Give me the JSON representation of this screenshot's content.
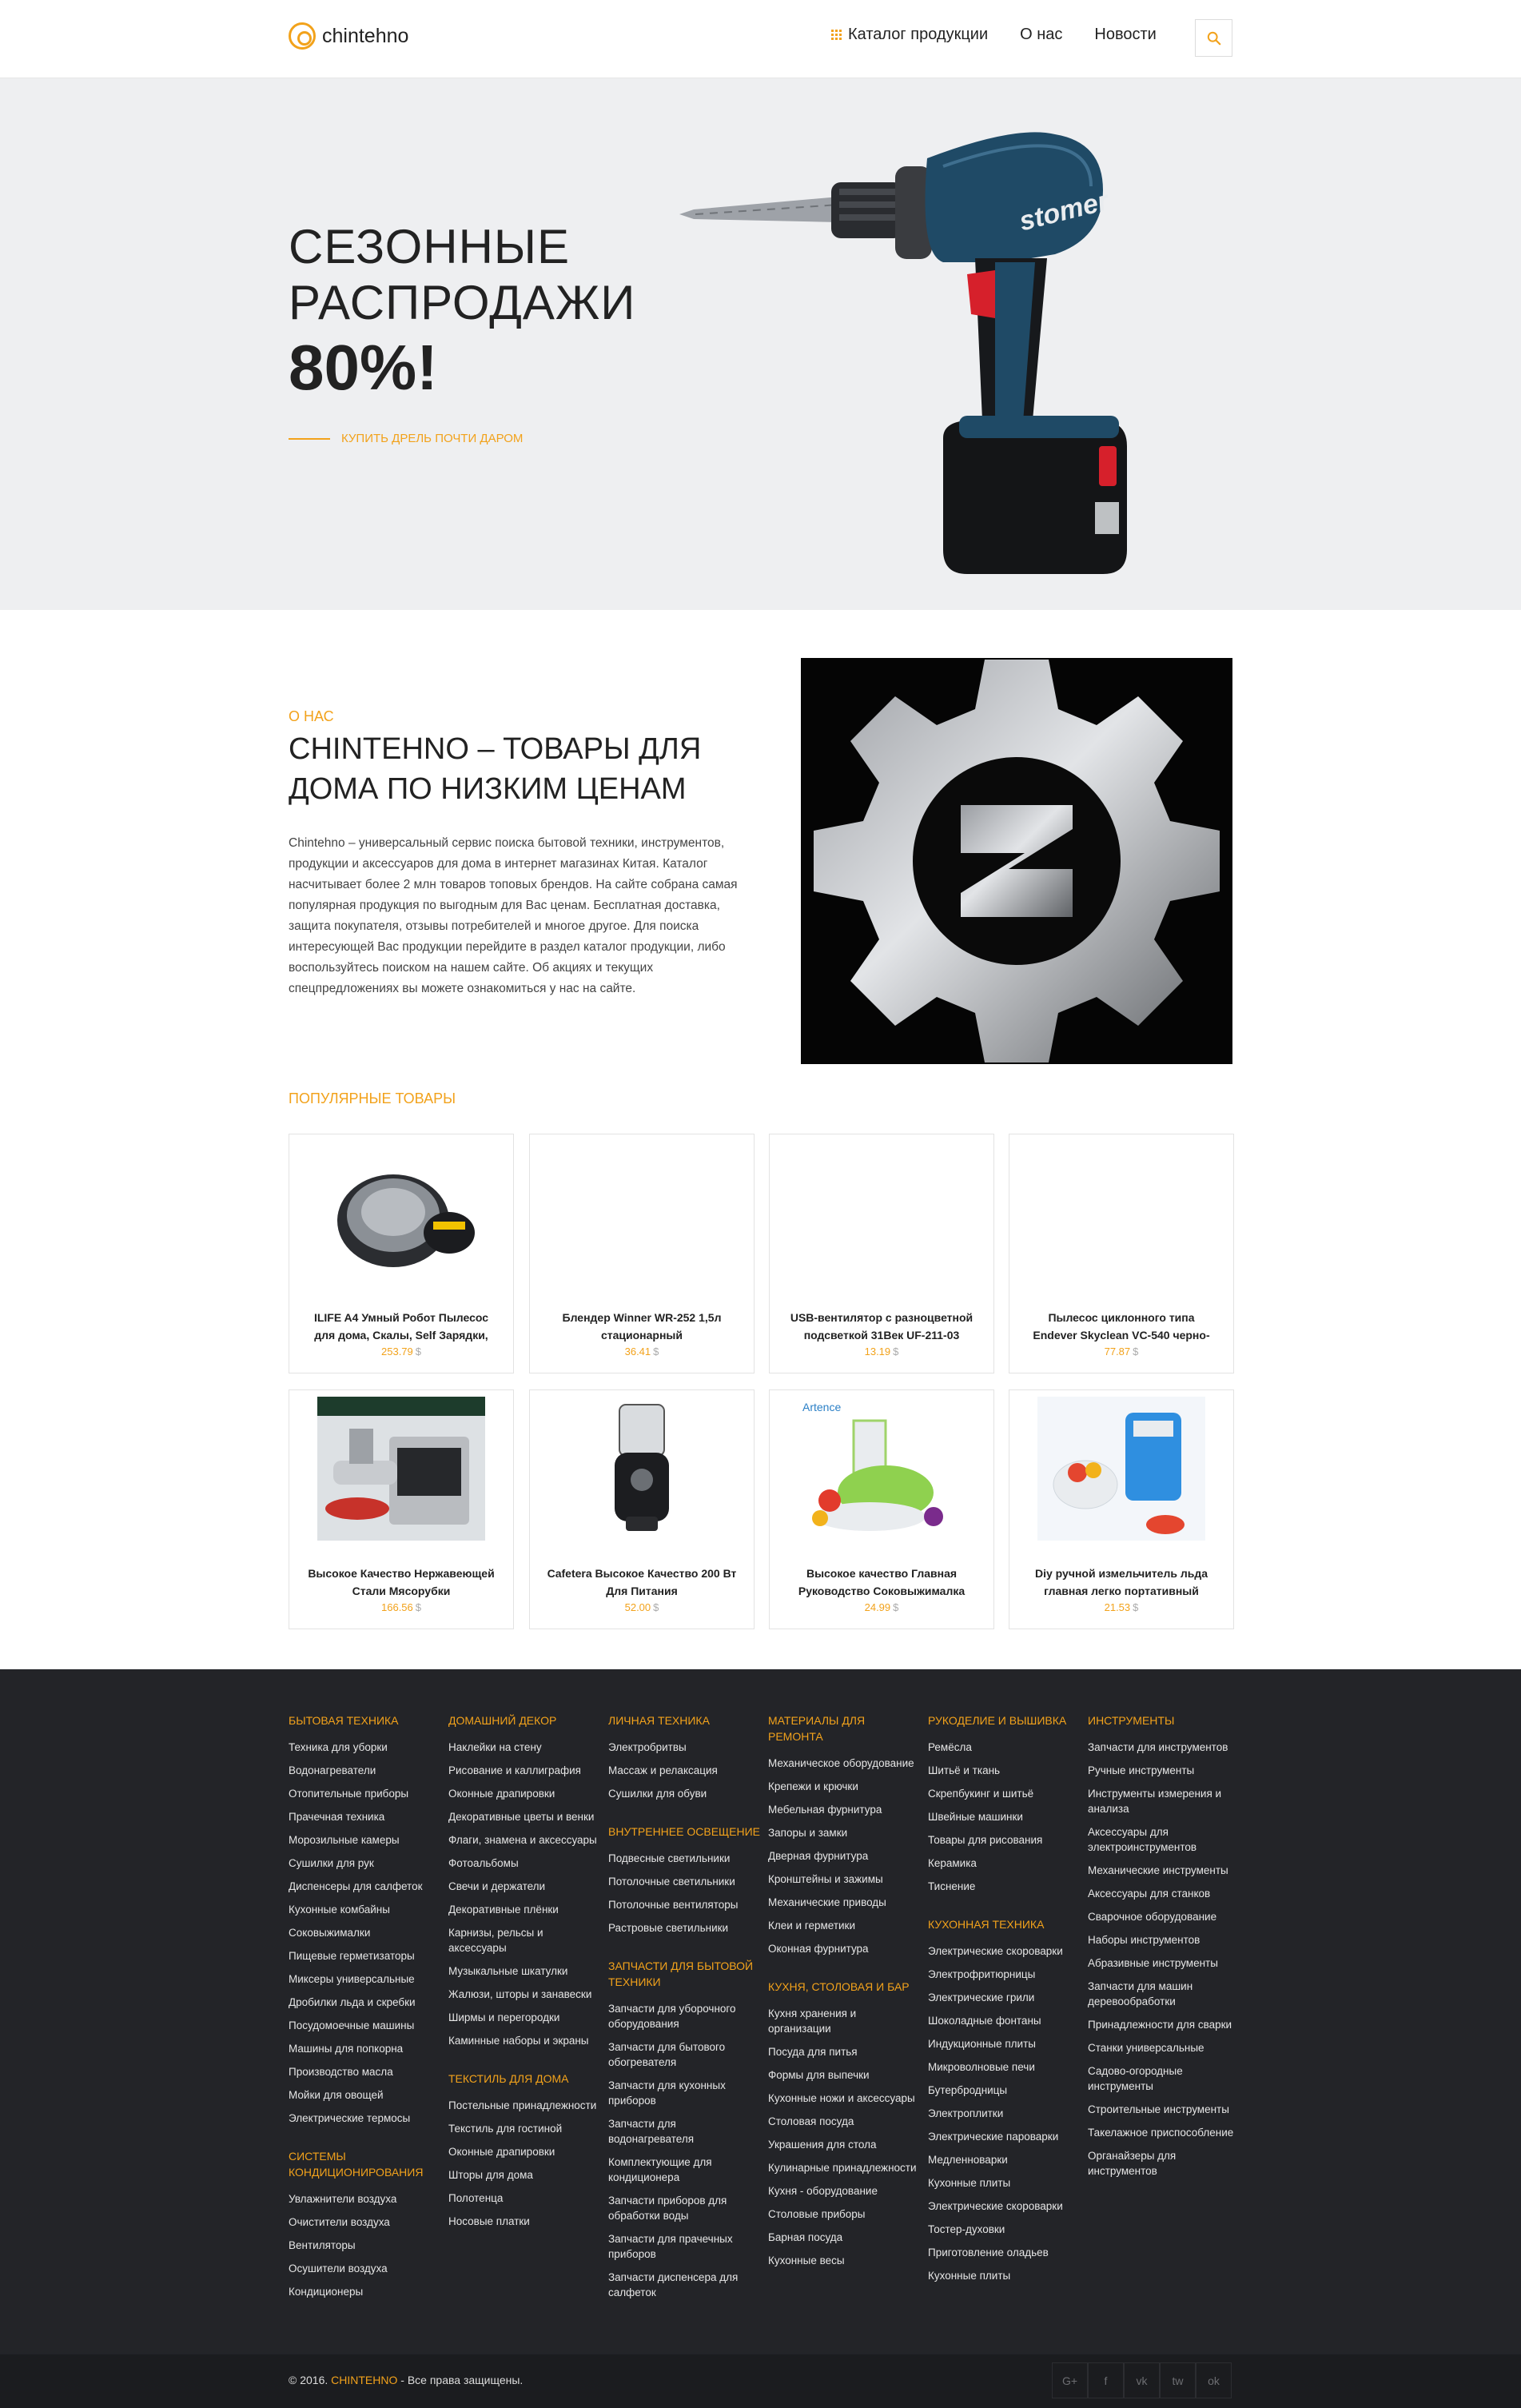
{
  "header": {
    "logo_text": "chintehno",
    "nav": [
      "Каталог продукции",
      "О нас",
      "Новости"
    ]
  },
  "hero": {
    "line1": "СЕЗОННЫЕ",
    "line2": "РАСПРОДАЖИ",
    "big": "80%!",
    "cta": "КУПИТЬ ДРЕЛЬ ПОЧТИ ДАРОМ",
    "drill_brand": "stomer"
  },
  "about": {
    "kicker": "О НАС",
    "title": "CHINTEHNO – ТОВАРЫ ДЛЯ ДОМА ПО НИЗКИМ ЦЕНАМ",
    "text": "Chintehno – универсальный сервис поиска бытовой техники, инструментов, продукции и аксессуаров для дома в интернет магазинах Китая. Каталог насчитывает более 2 млн товаров топовых брендов. На сайте собрана самая популярная продукция по выгодным для Вас ценам. Бесплатная доставка, защита покупателя, отзывы потребителей и многое другое. Для поиска интересующей Вас продукции перейдите в раздел каталог продукции, либо воспользуйтесь поиском на нашем сайте. Об акциях и текущих спецпредложениях вы можете ознакомиться у нас на сайте."
  },
  "popular": {
    "title": "ПОПУЛЯРНЫЕ ТОВАРЫ",
    "currency": "$",
    "products": [
      {
        "name": "ILIFE A4 Умный Робот Пылесос для дома, Скалы, Self Зарядки,",
        "price": "253.79",
        "image": "robot-vacuum"
      },
      {
        "name": "Блендер Winner WR-252 1,5л стационарный",
        "price": "36.41",
        "image": "none"
      },
      {
        "name": "USB-вентилятор с разноцветной подсветкой 31Век UF-211-03",
        "price": "13.19",
        "image": "none"
      },
      {
        "name": "Пылесос циклонного типа Endever Skyclean VC-540 черно-",
        "price": "77.87",
        "image": "none"
      },
      {
        "name": "Высокое Качество Нержавеющей Стали Мясорубки",
        "price": "166.56",
        "image": "meat-grinder"
      },
      {
        "name": "Cafetera Высокое Качество 200 Вт Для Питания",
        "price": "52.00",
        "image": "coffee-grinder"
      },
      {
        "name": "Высокое качество Главная Руководство Соковыжималка",
        "price": "24.99",
        "image": "juicer"
      },
      {
        "name": "Diy ручной измельчитель льда главная легко портативный",
        "price": "21.53",
        "image": "ice-crusher"
      }
    ]
  },
  "footer": {
    "columns": [
      {
        "groups": [
          {
            "title": "БЫТОВАЯ ТЕХНИКА",
            "items": [
              "Техника для уборки",
              "Водонагреватели",
              "Отопительные приборы",
              "Прачечная техника",
              "Морозильные камеры",
              "Сушилки для рук",
              "Диспенсеры для салфеток",
              "Кухонные комбайны",
              "Соковыжималки",
              "Пищевые герметизаторы",
              "Миксеры универсальные",
              "Дробилки льда и скребки",
              "Посудомоечные машины",
              "Машины для попкорна",
              "Производство масла",
              "Мойки для овощей",
              "Электрические термосы"
            ]
          },
          {
            "title": "СИСТЕМЫ КОНДИЦИОНИРОВАНИЯ",
            "items": [
              "Увлажнители воздуха",
              "Очистители воздуха",
              "Вентиляторы",
              "Осушители воздуха",
              "Кондиционеры"
            ]
          }
        ]
      },
      {
        "groups": [
          {
            "title": "ДОМАШНИЙ ДЕКОР",
            "items": [
              "Наклейки на стену",
              "Рисование и каллиграфия",
              "Оконные драпировки",
              "Декоративные цветы и венки",
              "Флаги, знамена и аксессуары",
              "Фотоальбомы",
              "Свечи и держатели",
              "Декоративные плёнки",
              "Карнизы, рельсы и аксессуары",
              "Музыкальные шкатулки",
              "Жалюзи, шторы и занавески",
              "Ширмы и перегородки",
              "Каминные наборы и экраны"
            ]
          },
          {
            "title": "ТЕКСТИЛЬ ДЛЯ ДОМА",
            "items": [
              "Постельные принадлежности",
              "Текстиль для гостиной",
              "Оконные драпировки",
              "Шторы для дома",
              "Полотенца",
              "Носовые платки"
            ]
          }
        ]
      },
      {
        "groups": [
          {
            "title": "ЛИЧНАЯ ТЕХНИКА",
            "items": [
              "Электробритвы",
              "Массаж и релаксация",
              "Сушилки для обуви"
            ]
          },
          {
            "title": "ВНУТРЕННЕЕ ОСВЕЩЕНИЕ",
            "items": [
              "Подвесные светильники",
              "Потолочные светильники",
              "Потолочные вентиляторы",
              "Растровые светильники"
            ]
          },
          {
            "title": "ЗАПЧАСТИ ДЛЯ БЫТОВОЙ ТЕХНИКИ",
            "items": [
              "Запчасти для уборочного оборудования",
              "Запчасти для бытового обогревателя",
              "Запчасти для кухонных приборов",
              "Запчасти для водонагревателя",
              "Комплектующие для кондиционера",
              "Запчасти приборов для обработки воды",
              "Запчасти для прачечных приборов",
              "Запчасти диспенсера для салфеток"
            ]
          }
        ]
      },
      {
        "groups": [
          {
            "title": "МАТЕРИАЛЫ ДЛЯ РЕМОНТА",
            "items": [
              "Механическое оборудование",
              "Крепежи и крючки",
              "Мебельная фурнитура",
              "Запоры и замки",
              "Дверная фурнитура",
              "Кронштейны и зажимы",
              "Механические приводы",
              "Клеи и герметики",
              "Оконная фурнитура"
            ]
          },
          {
            "title": "КУХНЯ, СТОЛОВАЯ И БАР",
            "items": [
              "Кухня хранения и организации",
              "Посуда для питья",
              "Формы для выпечки",
              "Кухонные ножи и аксессуары",
              "Столовая посуда",
              "Украшения для стола",
              "Кулинарные принадлежности",
              "Кухня - оборудование",
              "Столовые приборы",
              "Барная посуда",
              "Кухонные весы"
            ]
          }
        ]
      },
      {
        "groups": [
          {
            "title": "РУКОДЕЛИЕ И ВЫШИВКА",
            "items": [
              "Ремёсла",
              "Шитьё и ткань",
              "Скрепбукинг и шитьё",
              "Швейные машинки",
              "Товары для рисования",
              "Керамика",
              "Тиснение"
            ]
          },
          {
            "title": "КУХОННАЯ ТЕХНИКА",
            "items": [
              "Электрические скороварки",
              "Электрофритюрницы",
              "Электрические грили",
              "Шоколадные фонтаны",
              "Индукционные плиты",
              "Микроволновые печи",
              "Бутербродницы",
              "Электроплитки",
              "Электрические пароварки",
              "Медленноварки",
              "Кухонные плиты",
              "Электрические скороварки",
              "Тостер-духовки",
              "Приготовление оладьев",
              "Кухонные плиты"
            ]
          }
        ]
      },
      {
        "groups": [
          {
            "title": "ИНСТРУМЕНТЫ",
            "items": [
              "Запчасти для инструментов",
              "Ручные инструменты",
              "Инструменты измерения и анализа",
              "Аксессуары для электроинструментов",
              "Механические инструменты",
              "Аксессуары для станков",
              "Сварочное оборудование",
              "Наборы инструментов",
              "Абразивные инструменты",
              "Запчасти для машин деревообработки",
              "Принадлежности для сварки",
              "Станки универсальные",
              "Садово-огородные инструменты",
              "Строительные инструменты",
              "Такелажное приспособление",
              "Органайзеры для инструментов"
            ]
          }
        ]
      }
    ],
    "copyright_prefix": "© 2016.",
    "copyright_brand": "CHINTEHNO",
    "copyright_suffix": "- Все права защищены.",
    "socials": [
      "G+",
      "f",
      "vk",
      "tw",
      "ok"
    ]
  }
}
